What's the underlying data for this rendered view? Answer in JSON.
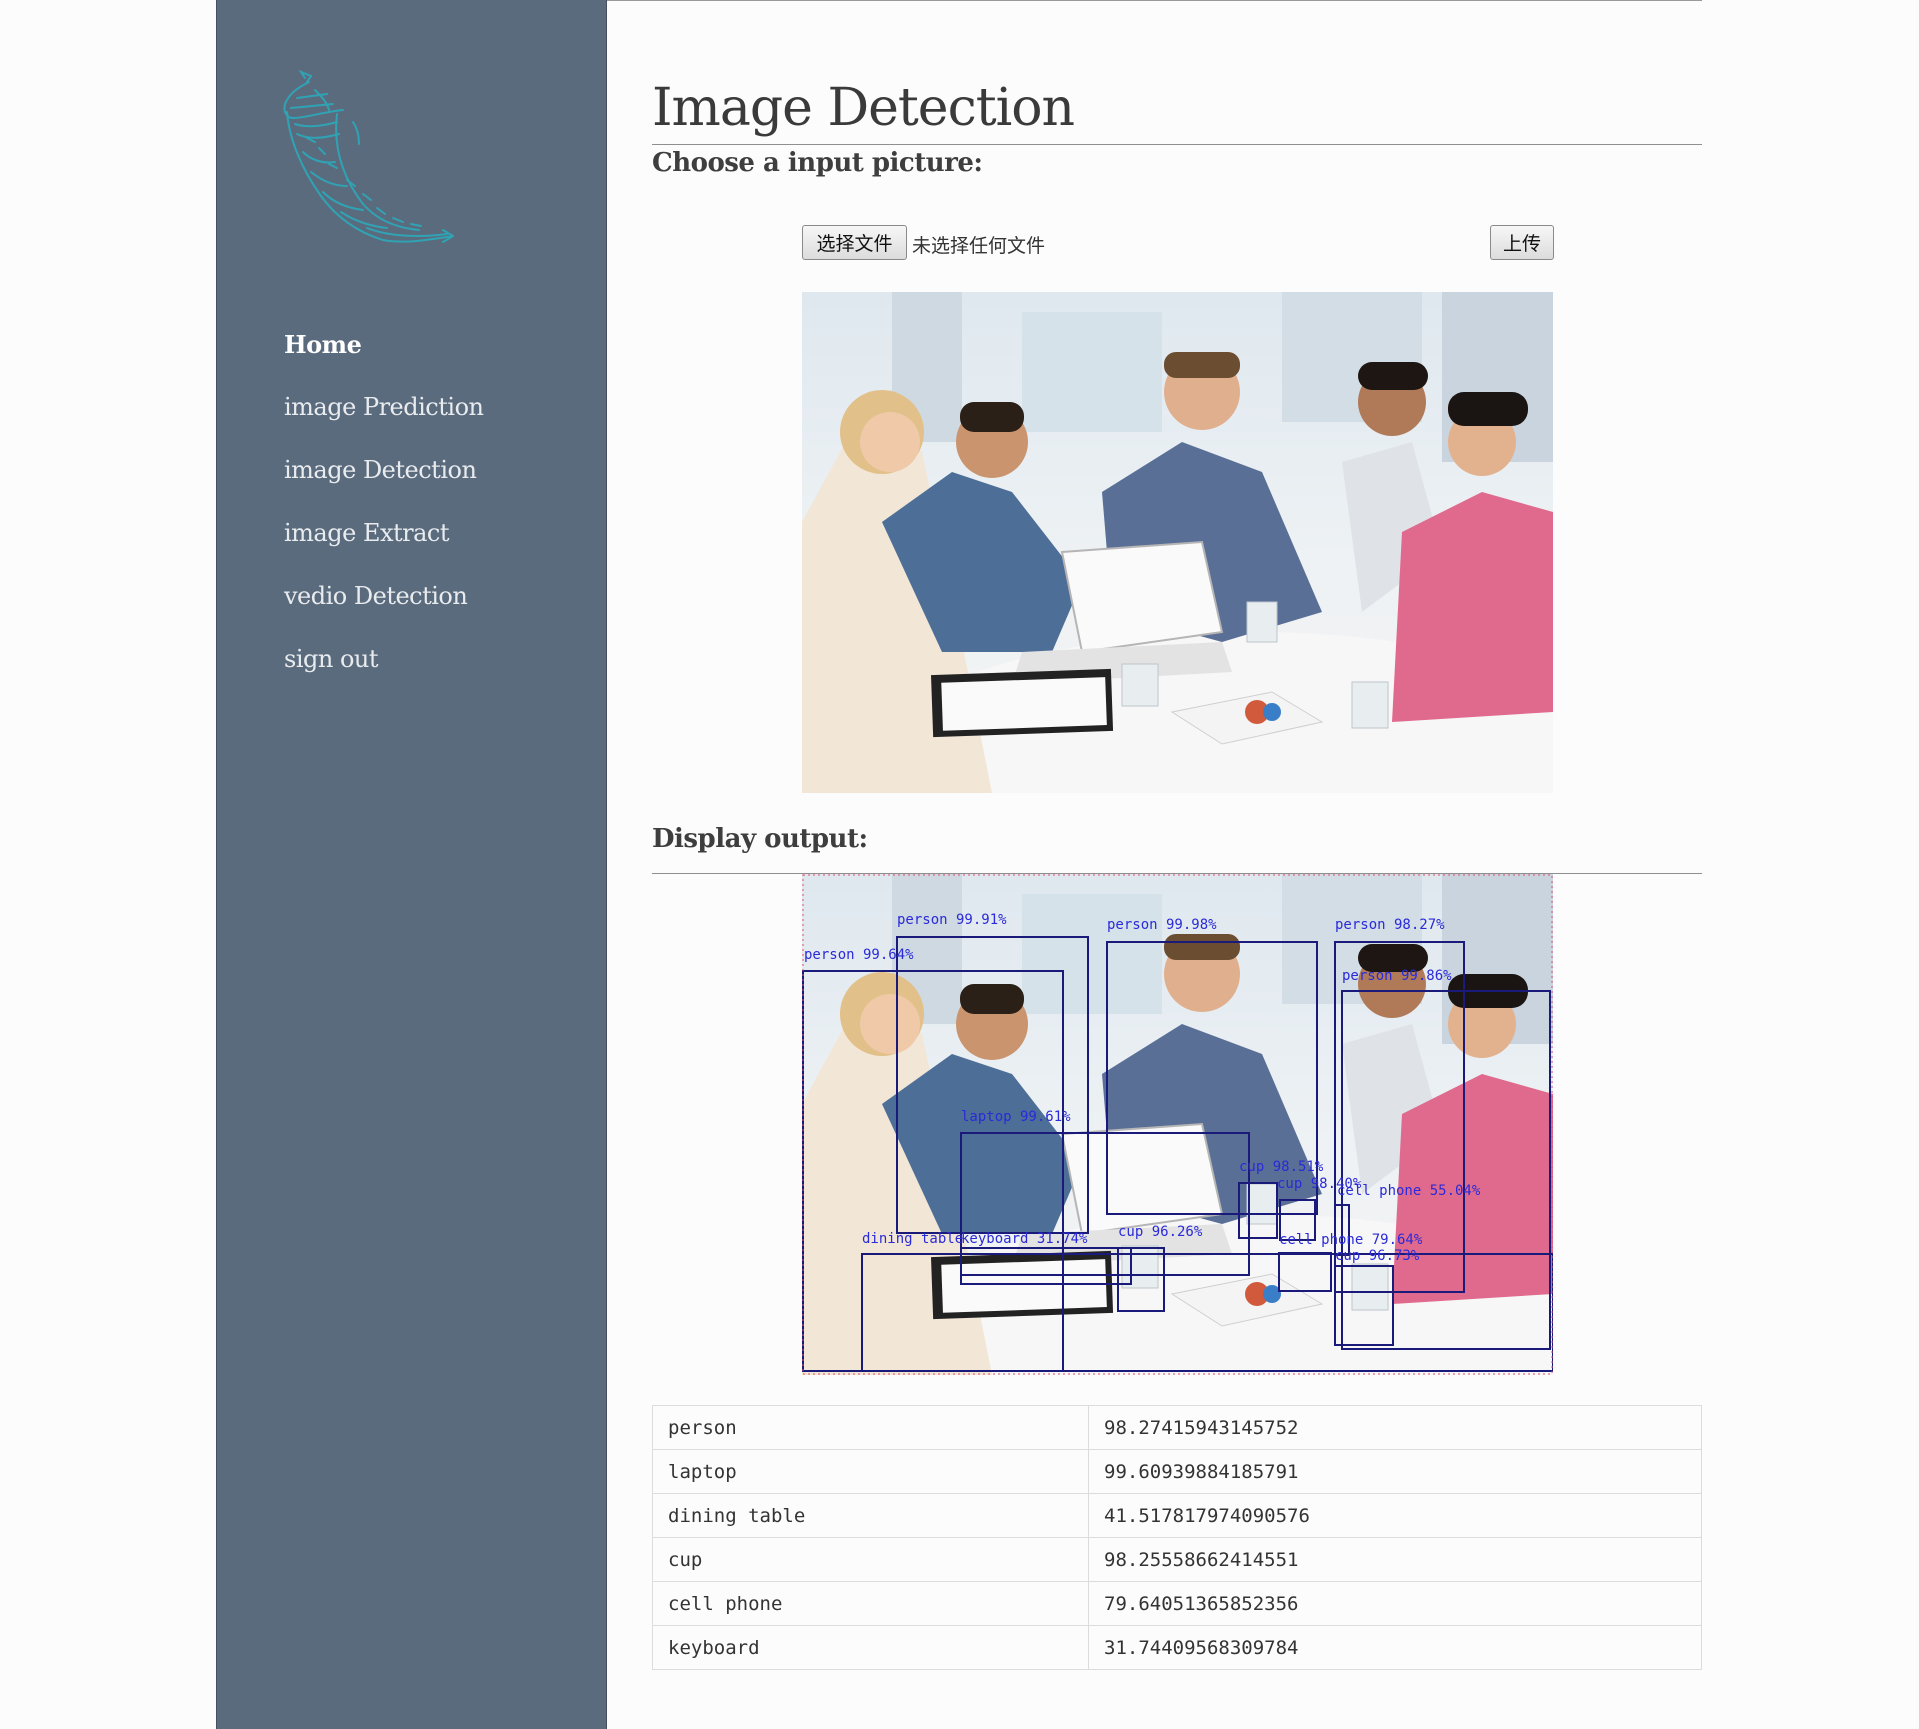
{
  "sidebar": {
    "nav": [
      {
        "label": "Home"
      },
      {
        "label": "image Prediction"
      },
      {
        "label": "image Detection"
      },
      {
        "label": "image Extract"
      },
      {
        "label": "vedio Detection"
      },
      {
        "label": "sign out"
      }
    ]
  },
  "main": {
    "title": "Image Detection",
    "input_heading": "Choose a input picture:",
    "choose_file_label": "选择文件",
    "file_status": "未选择任何文件",
    "upload_label": "上传",
    "output_heading": "Display output:"
  },
  "detections_overlay": [
    {
      "label": "person 99.91%"
    },
    {
      "label": "person 99.98%"
    },
    {
      "label": "person 98.27%"
    },
    {
      "label": "person 99.64%"
    },
    {
      "label": "person 99.86%"
    },
    {
      "label": "laptop 99.61%"
    },
    {
      "label": "cup 98.51%"
    },
    {
      "label": "cup 98.40%"
    },
    {
      "label": "cell phone 55.04%"
    },
    {
      "label": "dining table"
    },
    {
      "label": "keyboard 31.74%"
    },
    {
      "label": "cup 96.26%"
    },
    {
      "label": "cell phone 79.64%"
    },
    {
      "label": "cup 96.73%"
    }
  ],
  "results_table": [
    {
      "name": "person",
      "score": "98.27415943145752"
    },
    {
      "name": "laptop",
      "score": "99.60939884185791"
    },
    {
      "name": "dining table",
      "score": "41.517817974090576"
    },
    {
      "name": "cup",
      "score": "98.25558662414551"
    },
    {
      "name": "cell phone",
      "score": "79.64051365852356"
    },
    {
      "name": "keyboard",
      "score": "31.74409568309784"
    }
  ],
  "colors": {
    "sidebar_bg": "#5b6b7e",
    "logo": "#2fa3b4",
    "box": "#1a1a7a",
    "box_label": "#2a2ad8"
  }
}
